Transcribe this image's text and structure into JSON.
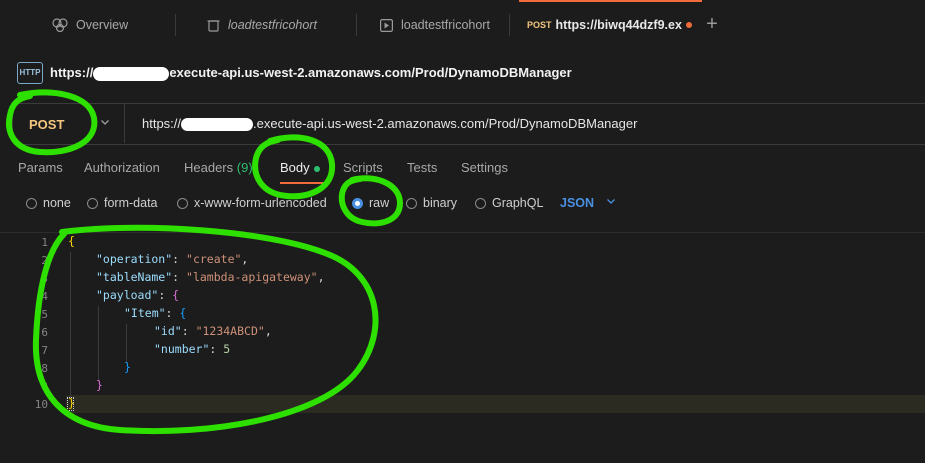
{
  "tabs": [
    {
      "label": "Overview",
      "icon": "overview-icon"
    },
    {
      "label": "loadtestfricohort",
      "icon": "trash-icon"
    },
    {
      "label": "loadtestfricohort",
      "icon": "play-icon"
    },
    {
      "method": "POST",
      "label": "https://biwq44dzf9.ex",
      "icon": "unsaved-dot-icon"
    }
  ],
  "new_tab_label": "+",
  "request": {
    "icon_label": "HTTP",
    "title_prefix": "https://",
    "title_suffix": "execute-api.us-west-2.amazonaws.com/Prod/DynamoDBManager",
    "method": "POST",
    "url_prefix": "https://",
    "url_suffix": ".execute-api.us-west-2.amazonaws.com/Prod/DynamoDBManager"
  },
  "subtabs": {
    "params": "Params",
    "authorization": "Authorization",
    "headers": "Headers",
    "headers_count": "(9)",
    "body": "Body",
    "scripts": "Scripts",
    "tests": "Tests",
    "settings": "Settings"
  },
  "body_types": {
    "none": "none",
    "form_data": "form-data",
    "urlencoded": "x-www-form-urlencoded",
    "raw": "raw",
    "binary": "binary",
    "graphql": "GraphQL",
    "selected": "raw",
    "format": "JSON"
  },
  "editor": {
    "line_numbers": [
      "1",
      "2",
      "3",
      "4",
      "5",
      "6",
      "7",
      "8",
      "9",
      "10"
    ],
    "code": {
      "l1": "{",
      "l2_key": "\"operation\"",
      "l2_val": "\"create\"",
      "l3_key": "\"tableName\"",
      "l3_val": "\"lambda-apigateway\"",
      "l4_key": "\"payload\"",
      "l5_key": "\"Item\"",
      "l6_key": "\"id\"",
      "l6_val": "\"1234ABCD\"",
      "l7_key": "\"number\"",
      "l7_val": "5",
      "l8": "}",
      "l9": "}",
      "l10": "}"
    }
  },
  "colors": {
    "accent": "#f26b3a",
    "annotation": "#2ee000",
    "method": "#f5c77e",
    "link": "#4a90e2"
  }
}
